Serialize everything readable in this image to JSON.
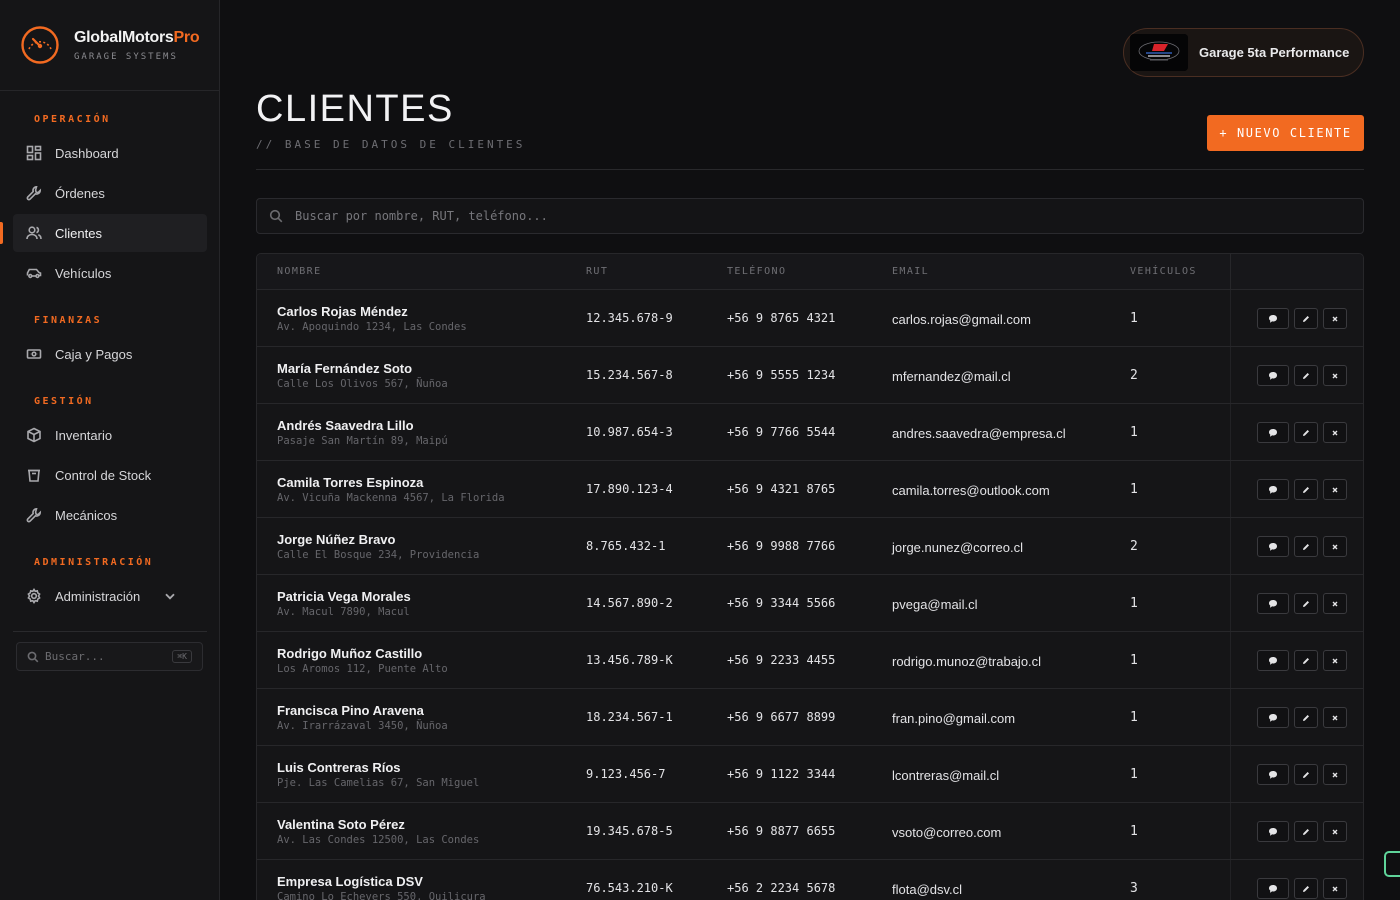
{
  "brand": {
    "name": "GlobalMotors",
    "name_accent": "Pro",
    "subtitle": "GARAGE SYSTEMS"
  },
  "sidebar": {
    "sections": [
      {
        "title": "OPERACIÓN",
        "items": [
          {
            "label": "Dashboard",
            "icon": "grid-icon"
          },
          {
            "label": "Órdenes",
            "icon": "wrench-icon"
          },
          {
            "label": "Clientes",
            "icon": "users-icon",
            "active": true
          },
          {
            "label": "Vehículos",
            "icon": "car-icon"
          }
        ]
      },
      {
        "title": "FINANZAS",
        "items": [
          {
            "label": "Caja y Pagos",
            "icon": "cash-icon"
          }
        ]
      },
      {
        "title": "GESTIÓN",
        "items": [
          {
            "label": "Inventario",
            "icon": "box-icon"
          },
          {
            "label": "Control de Stock",
            "icon": "bin-icon"
          },
          {
            "label": "Mecánicos",
            "icon": "wrench-icon"
          }
        ]
      },
      {
        "title": "ADMINISTRACIÓN",
        "items": [
          {
            "label": "Administración",
            "icon": "gear-icon"
          }
        ]
      }
    ],
    "search_placeholder": "Buscar...",
    "search_shortcut": "⌘K"
  },
  "header": {
    "garage_name": "Garage 5ta Performance",
    "title": "CLIENTES",
    "subtitle": "// BASE DE DATOS DE CLIENTES",
    "new_button": "+ NUEVO CLIENTE"
  },
  "search": {
    "placeholder": "Buscar por nombre, RUT, teléfono..."
  },
  "table": {
    "columns": [
      "NOMBRE",
      "RUT",
      "TELÉFONO",
      "EMAIL",
      "VEHÍCULOS"
    ],
    "rows": [
      {
        "name": "Carlos Rojas Méndez",
        "address": "Av. Apoquindo 1234, Las Condes",
        "rut": "12.345.678-9",
        "phone": "+56 9 8765 4321",
        "email": "carlos.rojas@gmail.com",
        "vehicles": "1"
      },
      {
        "name": "María Fernández Soto",
        "address": "Calle Los Olivos 567, Ñuñoa",
        "rut": "15.234.567-8",
        "phone": "+56 9 5555 1234",
        "email": "mfernandez@mail.cl",
        "vehicles": "2"
      },
      {
        "name": "Andrés Saavedra Lillo",
        "address": "Pasaje San Martín 89, Maipú",
        "rut": "10.987.654-3",
        "phone": "+56 9 7766 5544",
        "email": "andres.saavedra@empresa.cl",
        "vehicles": "1"
      },
      {
        "name": "Camila Torres Espinoza",
        "address": "Av. Vicuña Mackenna 4567, La Florida",
        "rut": "17.890.123-4",
        "phone": "+56 9 4321 8765",
        "email": "camila.torres@outlook.com",
        "vehicles": "1"
      },
      {
        "name": "Jorge Núñez Bravo",
        "address": "Calle El Bosque 234, Providencia",
        "rut": "8.765.432-1",
        "phone": "+56 9 9988 7766",
        "email": "jorge.nunez@correo.cl",
        "vehicles": "2"
      },
      {
        "name": "Patricia Vega Morales",
        "address": "Av. Macul 7890, Macul",
        "rut": "14.567.890-2",
        "phone": "+56 9 3344 5566",
        "email": "pvega@mail.cl",
        "vehicles": "1"
      },
      {
        "name": "Rodrigo Muñoz Castillo",
        "address": "Los Aromos 112, Puente Alto",
        "rut": "13.456.789-K",
        "phone": "+56 9 2233 4455",
        "email": "rodrigo.munoz@trabajo.cl",
        "vehicles": "1"
      },
      {
        "name": "Francisca Pino Aravena",
        "address": "Av. Irarrázaval 3450, Ñuñoa",
        "rut": "18.234.567-1",
        "phone": "+56 9 6677 8899",
        "email": "fran.pino@gmail.com",
        "vehicles": "1"
      },
      {
        "name": "Luis Contreras Ríos",
        "address": "Pje. Las Camelias 67, San Miguel",
        "rut": "9.123.456-7",
        "phone": "+56 9 1122 3344",
        "email": "lcontreras@mail.cl",
        "vehicles": "1"
      },
      {
        "name": "Valentina Soto Pérez",
        "address": "Av. Las Condes 12500, Las Condes",
        "rut": "19.345.678-5",
        "phone": "+56 9 8877 6655",
        "email": "vsoto@correo.com",
        "vehicles": "1"
      },
      {
        "name": "Empresa Logística DSV",
        "address": "Camino Lo Echevers 550, Quilicura",
        "rut": "76.543.210-K",
        "phone": "+56 2 2234 5678",
        "email": "flota@dsv.cl",
        "vehicles": "3"
      }
    ]
  },
  "colors": {
    "accent": "#f26a21",
    "background": "#0f0f11",
    "sidebar": "#151517",
    "status_green": "#5fd49a"
  }
}
